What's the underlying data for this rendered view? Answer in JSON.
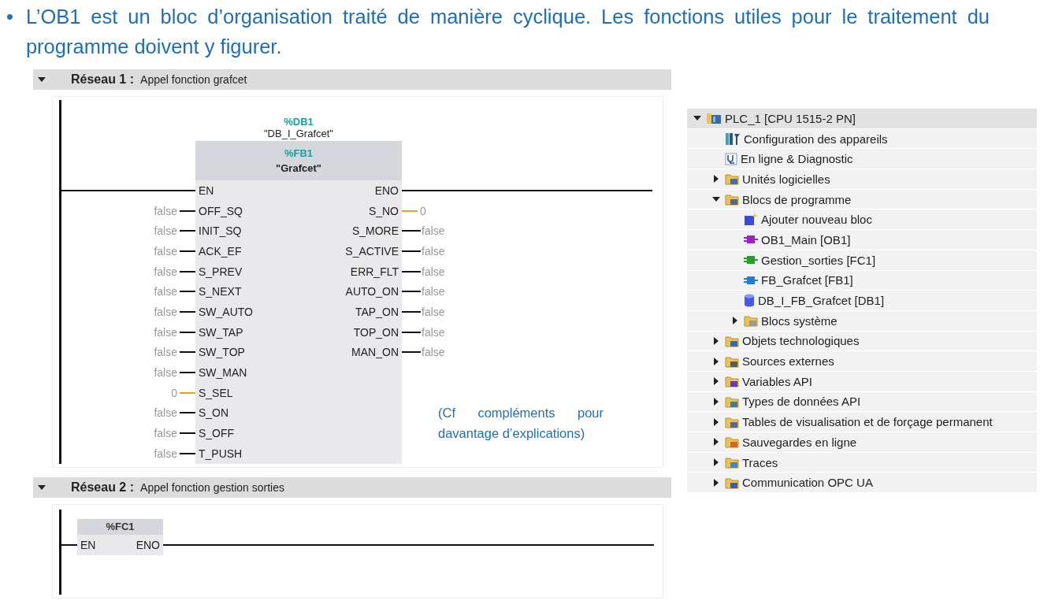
{
  "intro": {
    "bullet": "•",
    "text": "L’OB1 est un bloc d’organisation traité de manière cyclique. Les fonctions utiles pour le traitement du programme doivent y figurer."
  },
  "networks": [
    {
      "kind": "fb",
      "expanded": true,
      "title": "Réseau 1 :",
      "comment": "Appel fonction grafcet",
      "instance_address": "%DB1",
      "instance_name": "\"DB_I_Grafcet\"",
      "block_address": "%FB1",
      "block_name": "\"Grafcet\"",
      "en": "EN",
      "eno": "ENO",
      "inputs": [
        {
          "name": "OFF_SQ",
          "value": "false",
          "kind": "bool"
        },
        {
          "name": "INIT_SQ",
          "value": "false",
          "kind": "bool"
        },
        {
          "name": "ACK_EF",
          "value": "false",
          "kind": "bool"
        },
        {
          "name": "S_PREV",
          "value": "false",
          "kind": "bool"
        },
        {
          "name": "S_NEXT",
          "value": "false",
          "kind": "bool"
        },
        {
          "name": "SW_AUTO",
          "value": "false",
          "kind": "bool"
        },
        {
          "name": "SW_TAP",
          "value": "false",
          "kind": "bool"
        },
        {
          "name": "SW_TOP",
          "value": "false",
          "kind": "bool"
        },
        {
          "name": "SW_MAN",
          "value": "false",
          "kind": "bool"
        },
        {
          "name": "S_SEL",
          "value": "0",
          "kind": "int"
        },
        {
          "name": "S_ON",
          "value": "false",
          "kind": "bool"
        },
        {
          "name": "S_OFF",
          "value": "false",
          "kind": "bool"
        },
        {
          "name": "T_PUSH",
          "value": "false",
          "kind": "bool"
        }
      ],
      "outputs": [
        {
          "name": "S_NO",
          "value": "0",
          "kind": "int"
        },
        {
          "name": "S_MORE",
          "value": "false",
          "kind": "bool"
        },
        {
          "name": "S_ACTIVE",
          "value": "false",
          "kind": "bool"
        },
        {
          "name": "ERR_FLT",
          "value": "false",
          "kind": "bool"
        },
        {
          "name": "AUTO_ON",
          "value": "false",
          "kind": "bool"
        },
        {
          "name": "TAP_ON",
          "value": "false",
          "kind": "bool"
        },
        {
          "name": "TOP_ON",
          "value": "false",
          "kind": "bool"
        },
        {
          "name": "MAN_ON",
          "value": "false",
          "kind": "bool"
        }
      ],
      "note": "(Cf compléments pour davantage d’explications)"
    },
    {
      "kind": "fc",
      "expanded": true,
      "title": "Réseau 2 :",
      "comment": "Appel fonction gestion sorties",
      "block_address": "%FC1",
      "en": "EN",
      "eno": "ENO"
    }
  ],
  "tree": {
    "items": [
      {
        "label": "PLC_1 [CPU 1515-2 PN]",
        "kind": "plc",
        "expanded": true,
        "children": [
          {
            "label": "Configuration des appareils",
            "kind": "config"
          },
          {
            "label": "En ligne & Diagnostic",
            "kind": "diag"
          },
          {
            "label": "Unités logicielles",
            "kind": "folder",
            "color": "#3a6fc4",
            "expanded": false
          },
          {
            "label": "Blocs de programme",
            "kind": "folder",
            "color": "#4a6a9a",
            "expanded": true,
            "children": [
              {
                "label": "Ajouter nouveau bloc",
                "kind": "add"
              },
              {
                "label": "OB1_Main [OB1]",
                "kind": "block",
                "color": "#a020c8"
              },
              {
                "label": "Gestion_sorties [FC1]",
                "kind": "block",
                "color": "#22a02a"
              },
              {
                "label": "FB_Grafcet [FB1]",
                "kind": "block",
                "color": "#1e7fd8"
              },
              {
                "label": "DB_I_FB_Grafcet [DB1]",
                "kind": "db"
              },
              {
                "label": "Blocs système",
                "kind": "folder",
                "color": "#9a9a9a",
                "expanded": false
              }
            ]
          },
          {
            "label": "Objets technologiques",
            "kind": "folder",
            "color": "#2a6ad0",
            "expanded": false
          },
          {
            "label": "Sources externes",
            "kind": "folder",
            "color": "#505a70",
            "expanded": false
          },
          {
            "label": "Variables API",
            "kind": "folder",
            "color": "#6a3ab0",
            "expanded": false
          },
          {
            "label": "Types de données API",
            "kind": "folder",
            "color": "#4a7a9a",
            "expanded": false
          },
          {
            "label": "Tables de visualisation et de forçage permanent",
            "kind": "folder",
            "color": "#5a6a8a",
            "expanded": false
          },
          {
            "label": "Sauvegardes en ligne",
            "kind": "folder",
            "color": "#e06020",
            "expanded": false
          },
          {
            "label": "Traces",
            "kind": "folder",
            "color": "#3a8ad0",
            "expanded": false
          },
          {
            "label": "Communication OPC UA",
            "kind": "folder",
            "color": "#3a5ac0",
            "expanded": false
          }
        ]
      }
    ]
  }
}
